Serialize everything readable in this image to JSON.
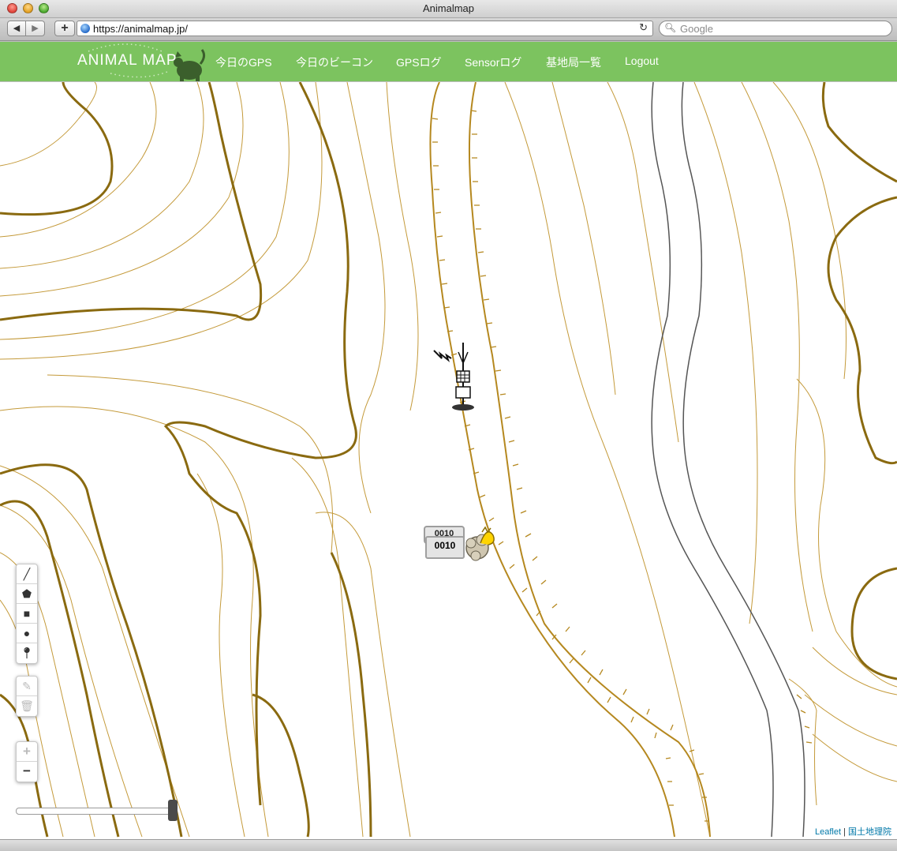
{
  "window": {
    "title": "Animalmap"
  },
  "browser": {
    "back_label": "◀",
    "forward_label": "▶",
    "add_label": "+",
    "url": "https://animalmap.jp/",
    "reload_label": "↻",
    "search_placeholder": "Google"
  },
  "header": {
    "logo": "ANIMAL MAP",
    "menu": [
      "今日のGPS",
      "今日のビーコン",
      "GPSログ",
      "Sensorログ",
      "基地局一覧",
      "Logout"
    ],
    "color": "#7cc35f"
  },
  "map": {
    "draw_tools": [
      "polyline-icon",
      "polygon-icon",
      "rectangle-icon",
      "circle-icon",
      "marker-icon"
    ],
    "edit_tools": [
      "edit-icon",
      "delete-icon"
    ],
    "zoom": {
      "in": "+",
      "out": "−"
    },
    "slider_value": 1.0,
    "animal_marker": {
      "label_back": "0010",
      "label_front": "0010"
    },
    "attribution": {
      "leaflet": "Leaflet",
      "separator": "|",
      "gsi": "国土地理院"
    },
    "contour_color": "#8a6a10",
    "road_color": "#555555"
  }
}
